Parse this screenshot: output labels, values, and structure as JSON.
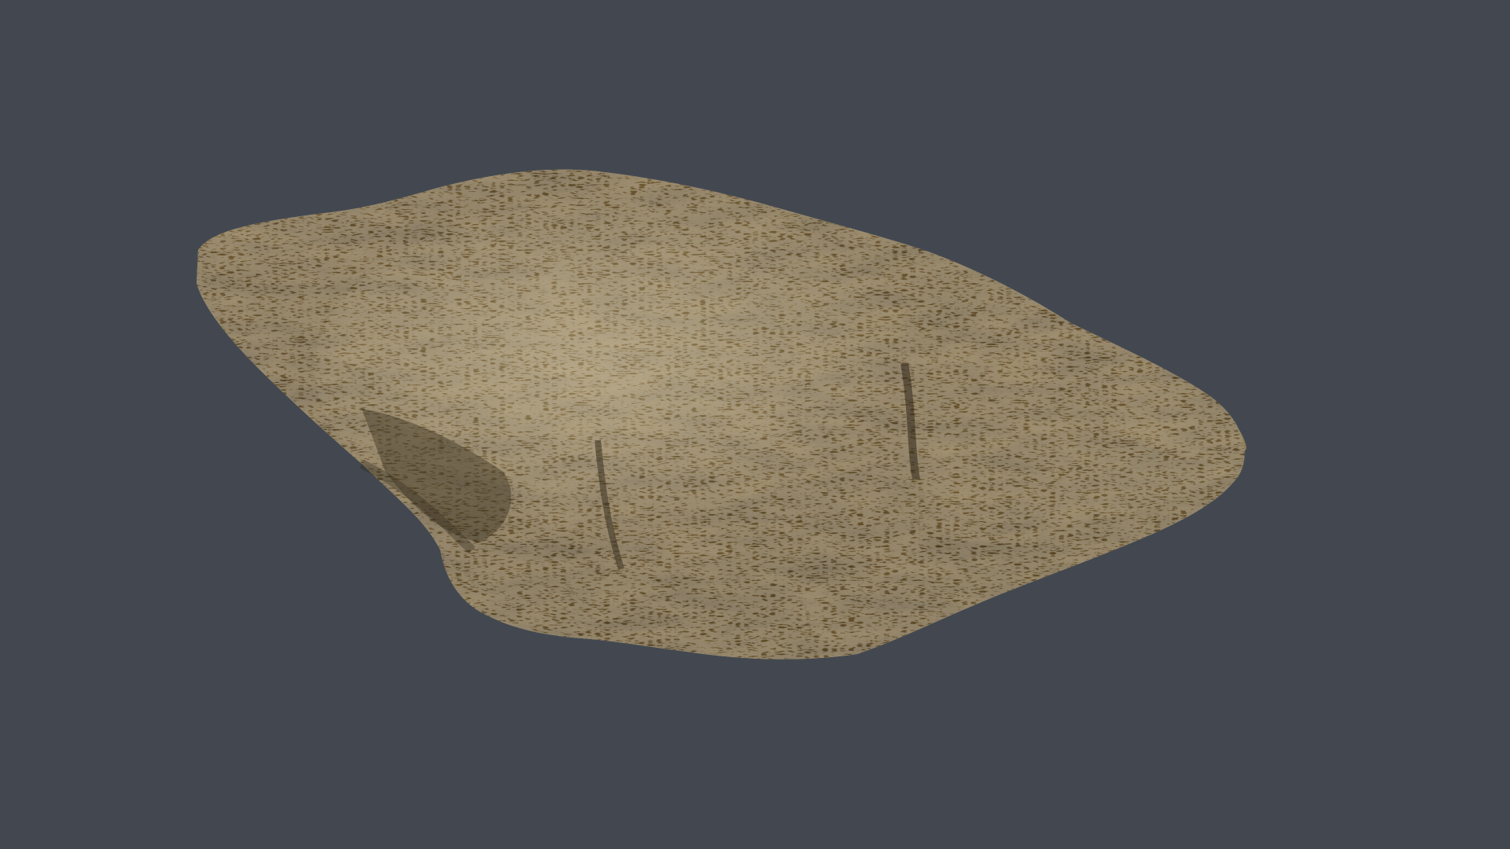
{
  "viewport": {
    "background_color": "#434850"
  },
  "model": {
    "name": "rock",
    "base_color": "#6b5a3c",
    "highlight_color": "#c9b98c",
    "shadow_color": "#3a3022",
    "speckle_color": "#e6ddc6"
  }
}
